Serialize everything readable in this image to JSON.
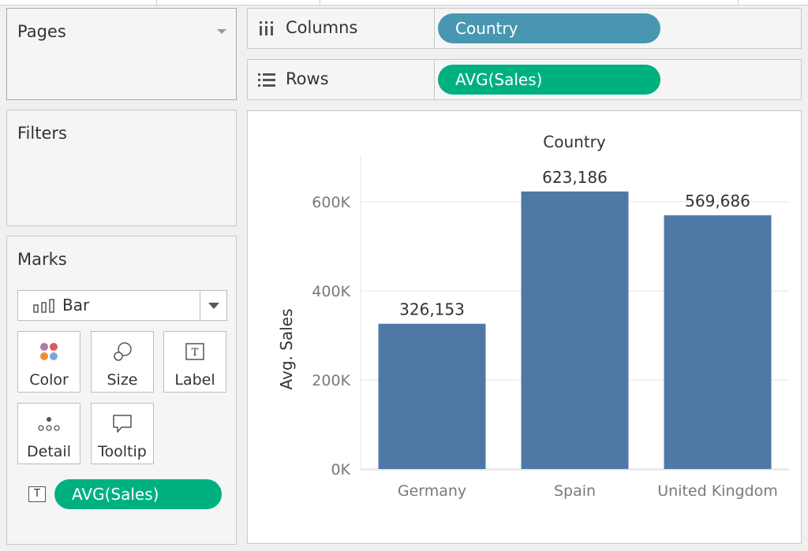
{
  "pages": {
    "title": "Pages"
  },
  "filters": {
    "title": "Filters"
  },
  "marks": {
    "title": "Marks",
    "mark_type": "Bar",
    "buttons": {
      "color": "Color",
      "size": "Size",
      "label": "Label",
      "detail": "Detail",
      "tooltip": "Tooltip"
    },
    "label_pill": "AVG(Sales)",
    "label_pill_icon": "T"
  },
  "shelves": {
    "columns": {
      "label": "Columns",
      "pill": "Country"
    },
    "rows": {
      "label": "Rows",
      "pill": "AVG(Sales)"
    }
  },
  "colors": {
    "dimension_pill": "#4996b2",
    "measure_pill": "#00b180",
    "bar": "#4e79a7"
  },
  "chart_data": {
    "type": "bar",
    "title": "Country",
    "xlabel": "",
    "ylabel": "Avg. Sales",
    "categories": [
      "Germany",
      "Spain",
      "United Kingdom"
    ],
    "values": [
      326153,
      623186,
      569686
    ],
    "value_labels": [
      "326,153",
      "623,186",
      "569,686"
    ],
    "yticks": [
      0,
      200000,
      400000,
      600000
    ],
    "ytick_labels": [
      "0K",
      "200K",
      "400K",
      "600K"
    ],
    "ylim": [
      0,
      700000
    ],
    "grid": true
  }
}
